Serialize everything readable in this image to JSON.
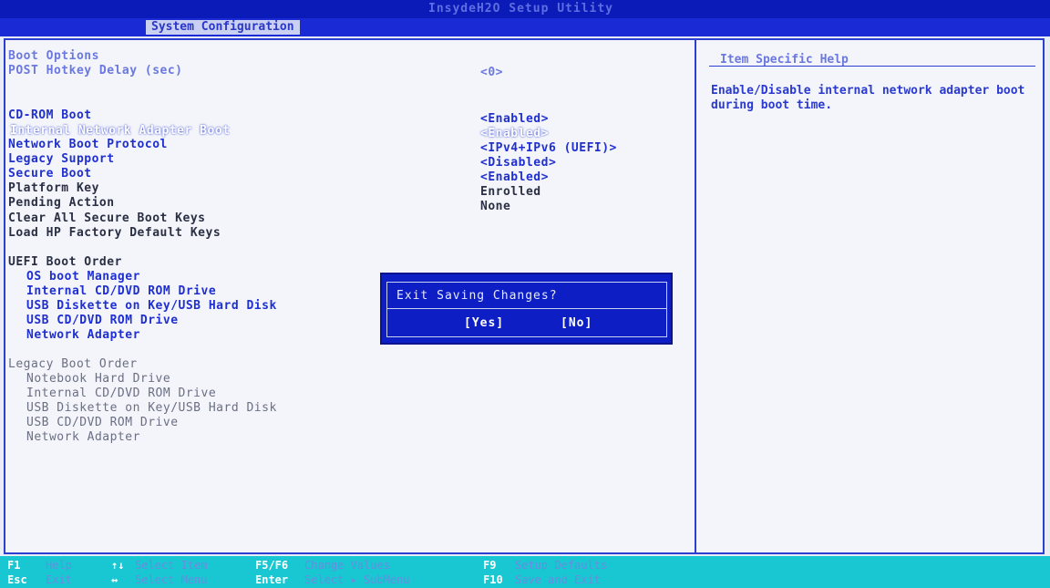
{
  "app": {
    "title": "InsydeH2O Setup Utility",
    "active_tab": "System Configuration"
  },
  "boot_options": {
    "heading": "Boot Options",
    "post_hotkey_delay": {
      "label": "POST Hotkey Delay (sec)",
      "value": "<0>"
    },
    "settings": [
      {
        "label": "CD-ROM Boot",
        "value": "<Enabled>"
      },
      {
        "label": "Internal Network Adapter Boot",
        "value": "<Enabled>"
      },
      {
        "label": "Network Boot Protocol",
        "value": "<IPv4+IPv6 (UEFI)>"
      },
      {
        "label": "Legacy Support",
        "value": "<Disabled>"
      },
      {
        "label": "Secure Boot",
        "value": "<Enabled>"
      },
      {
        "label": "Platform Key",
        "value": "Enrolled"
      },
      {
        "label": "Pending Action",
        "value": "None"
      },
      {
        "label": "Clear All Secure Boot Keys",
        "value": ""
      },
      {
        "label": "Load HP Factory Default Keys",
        "value": ""
      }
    ]
  },
  "uefi_boot_order": {
    "heading": "UEFI Boot Order",
    "items": [
      "OS boot Manager",
      "Internal CD/DVD ROM Drive",
      "USB Diskette on Key/USB Hard Disk",
      "USB CD/DVD ROM Drive",
      "Network Adapter"
    ]
  },
  "legacy_boot_order": {
    "heading": "Legacy Boot Order",
    "items": [
      "Notebook Hard Drive",
      "Internal CD/DVD ROM Drive",
      "USB Diskette on Key/USB Hard Disk",
      "USB CD/DVD ROM Drive",
      "Network Adapter"
    ]
  },
  "help": {
    "title": "Item Specific Help",
    "text": "Enable/Disable internal network adapter boot during boot time."
  },
  "dialog": {
    "message": "Exit Saving Changes?",
    "yes": "[Yes]",
    "no": "[No]"
  },
  "footer": {
    "row1": [
      {
        "key": "F1",
        "desc": "Help"
      },
      {
        "key": "↑↓",
        "desc": "Select Item"
      },
      {
        "key": "F5/F6",
        "desc": "Change Values"
      },
      {
        "key": "F9",
        "desc": "Setup Defaults"
      }
    ],
    "row2": [
      {
        "key": "Esc",
        "desc": "Exit"
      },
      {
        "key": "↔",
        "desc": "Select Menu"
      },
      {
        "key": "Enter",
        "desc": "Select ▸ SubMenu"
      },
      {
        "key": "F10",
        "desc": "Save and Exit"
      }
    ]
  }
}
